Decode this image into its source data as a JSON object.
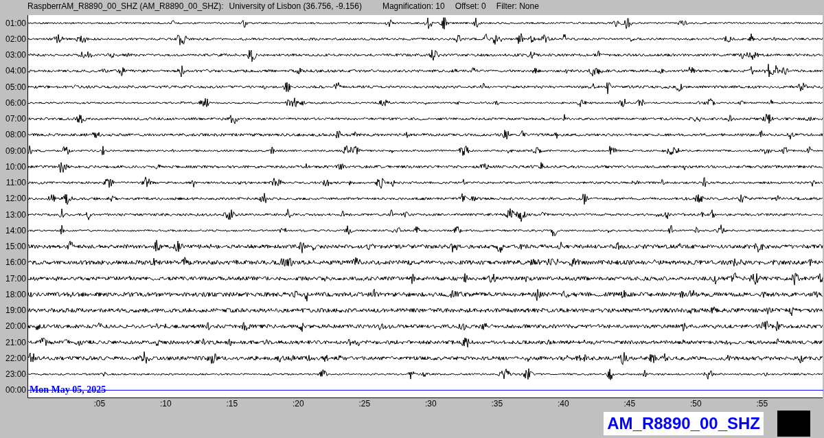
{
  "header": {
    "station": "RaspberrAM_R8890_00_SHZ (AM_R8890_00_SHZ):",
    "location": "University of Lisbon (36.756, -9.156)",
    "magnification": "Magnification: 10",
    "offset": "Offset: 0",
    "filter": "Filter: None"
  },
  "rows": [
    {
      "time": "01:00",
      "kind": "recorded"
    },
    {
      "time": "02:00",
      "kind": "recorded"
    },
    {
      "time": "03:00",
      "kind": "recorded"
    },
    {
      "time": "04:00",
      "kind": "recorded"
    },
    {
      "time": "05:00",
      "kind": "recorded"
    },
    {
      "time": "06:00",
      "kind": "recorded"
    },
    {
      "time": "07:00",
      "kind": "recorded"
    },
    {
      "time": "08:00",
      "kind": "recorded"
    },
    {
      "time": "09:00",
      "kind": "recorded"
    },
    {
      "time": "10:00",
      "kind": "recorded"
    },
    {
      "time": "11:00",
      "kind": "recorded"
    },
    {
      "time": "12:00",
      "kind": "recorded"
    },
    {
      "time": "13:00",
      "kind": "recorded"
    },
    {
      "time": "14:00",
      "kind": "recorded"
    },
    {
      "time": "15:00",
      "kind": "recorded"
    },
    {
      "time": "16:00",
      "kind": "recorded"
    },
    {
      "time": "17:00",
      "kind": "recorded"
    },
    {
      "time": "18:00",
      "kind": "recorded"
    },
    {
      "time": "19:00",
      "kind": "recorded"
    },
    {
      "time": "20:00",
      "kind": "recorded"
    },
    {
      "time": "21:00",
      "kind": "recorded"
    },
    {
      "time": "22:00",
      "kind": "recorded"
    },
    {
      "time": "23:00",
      "kind": "recorded"
    },
    {
      "time": "00:00",
      "kind": "current"
    }
  ],
  "date": "Mon May 05, 2025",
  "x_ticks": [
    ":05",
    ":10",
    ":15",
    ":20",
    ":25",
    ":30",
    ":35",
    ":40",
    ":45",
    ":50",
    ":55"
  ],
  "station_label": "AM_R8890_00_SHZ"
}
